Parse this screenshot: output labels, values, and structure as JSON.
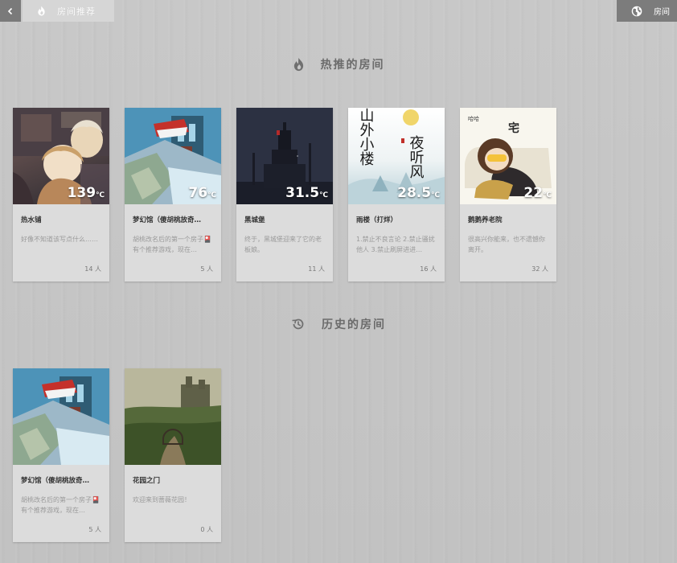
{
  "header": {
    "tab_label": "房间推荐",
    "rooms_label": "房间"
  },
  "sections": {
    "hot_title": "热推的房间",
    "history_title": "历史的房间"
  },
  "hot_rooms": [
    {
      "title": "热水铺",
      "desc": "好像不知道该写点什么……",
      "count": "14 人",
      "temp": "139",
      "unit": "℃"
    },
    {
      "title": "梦幻馆（傻胡桃放奇…",
      "desc": "胡桃改名后的第一个房子🎴有个推荐游戏，现在…",
      "count": "5 人",
      "temp": "76",
      "unit": "℃"
    },
    {
      "title": "黑城堡",
      "desc": "终于，黑城堡迎来了它的老板娘。",
      "count": "11 人",
      "temp": "31.5",
      "unit": "℃"
    },
    {
      "title": "雨楼（打烊）",
      "desc": "1.禁止不良言论 2.禁止骚扰他人 3.禁止刷屏进进…",
      "count": "16 人",
      "temp": "28.5",
      "unit": "℃"
    },
    {
      "title": "鹅鹅养老院",
      "desc": "很高兴你能来，也不遗憾你离开。",
      "count": "32 人",
      "temp": "22",
      "unit": "℃"
    }
  ],
  "history_rooms": [
    {
      "title": "梦幻馆（傻胡桃放奇…",
      "desc": "胡桃改名后的第一个房子🎴有个推荐游戏，现在…",
      "count": "5 人"
    },
    {
      "title": "花园之门",
      "desc": "欢迎来到蔷薇花园！",
      "count": "0 人"
    }
  ],
  "art_text": {
    "rain_left": "山外小楼",
    "rain_right": "夜听风",
    "pension_tag": "宅",
    "pension_cry": "哈哈"
  },
  "icons": {
    "back": "chevron-left-icon",
    "tab": "flame-icon",
    "rooms": "globe-icon",
    "hot": "flame-icon",
    "history": "history-icon"
  },
  "colors": {
    "background": "#c4c4c4",
    "card": "#dcdcdc",
    "top_dark": "#7a7a7a",
    "heading": "#6b6b6b"
  }
}
